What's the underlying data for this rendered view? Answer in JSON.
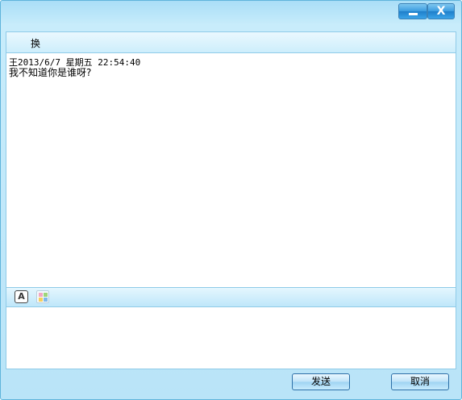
{
  "window": {
    "minimize_label": "—",
    "close_label": "X"
  },
  "contact": {
    "name": "换"
  },
  "history": {
    "messages": [
      {
        "header": "王2013/6/7 星期五 22:54:40",
        "body": "我不知道你是谁呀?"
      }
    ]
  },
  "toolbar": {
    "font_label": "A",
    "icons": [
      "font-icon",
      "emoji-icon"
    ]
  },
  "input": {
    "value": ""
  },
  "buttons": {
    "send_label": "发送",
    "cancel_label": "取消"
  },
  "colors": {
    "frame": "#b9e4f8",
    "border": "#8fcbe8",
    "title_button": "#3a9ce0"
  }
}
